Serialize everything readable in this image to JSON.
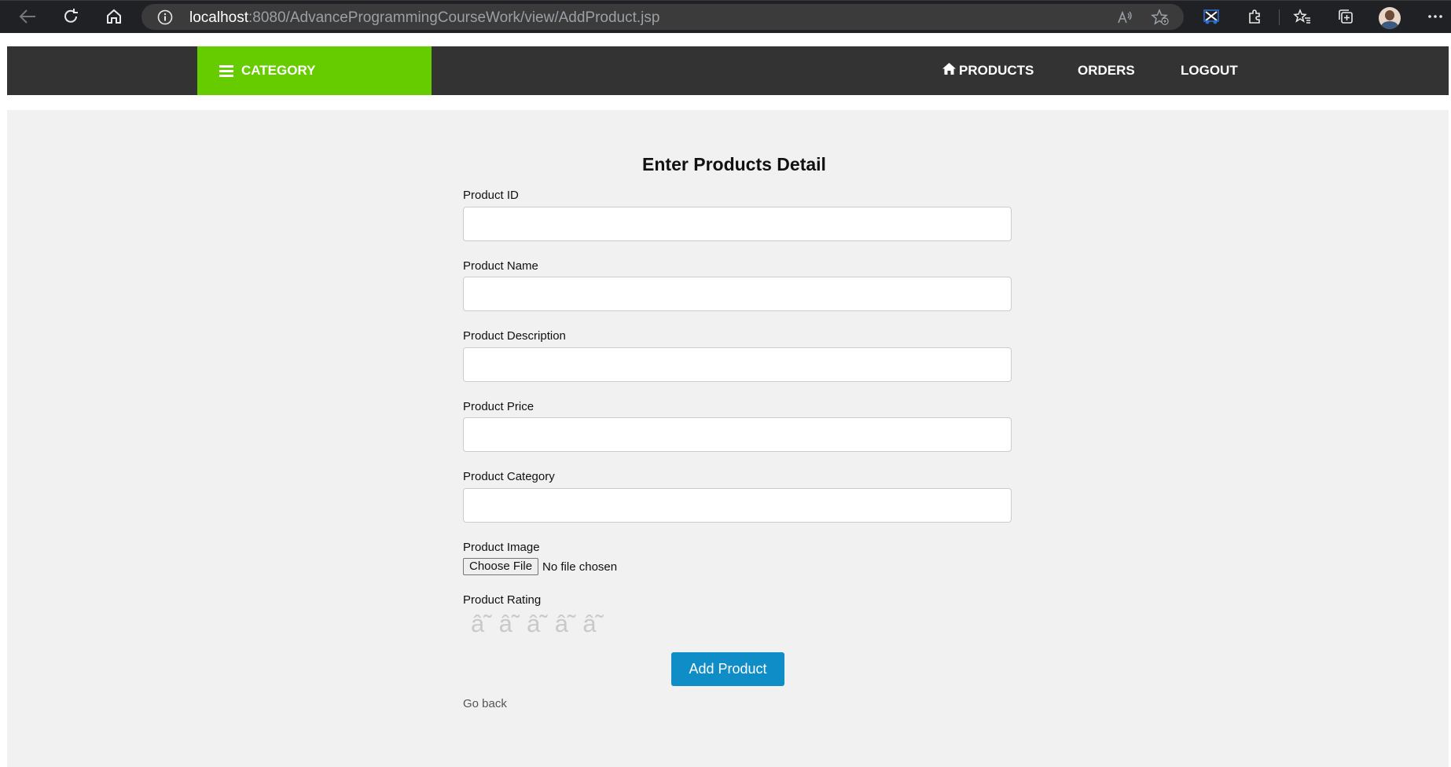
{
  "browser": {
    "url_host": "localhost",
    "url_rest": ":8080/AdvanceProgrammingCourseWork/view/AddProduct.jsp"
  },
  "nav": {
    "category_label": "CATEGORY",
    "links": [
      "PRODUCTS",
      "ORDERS",
      "LOGOUT"
    ]
  },
  "form": {
    "title": "Enter Products Detail",
    "fields": [
      {
        "label": "Product ID",
        "value": ""
      },
      {
        "label": "Product Name",
        "value": ""
      },
      {
        "label": "Product Description",
        "value": ""
      },
      {
        "label": "Product Price",
        "value": ""
      },
      {
        "label": "Product Category",
        "value": ""
      }
    ],
    "image_label": "Product Image",
    "file_button": "Choose File",
    "file_status": "No file chosen",
    "rating_label": "Product Rating",
    "rating_stars": [
      "â˜",
      "â˜",
      "â˜",
      "â˜",
      "â˜"
    ],
    "submit_label": "Add Product",
    "go_back": "Go back"
  },
  "colors": {
    "nav_bg": "#333333",
    "category_bg": "#66cc00",
    "submit_bg": "#0e8dc6",
    "page_bg": "#f1f1f1"
  }
}
